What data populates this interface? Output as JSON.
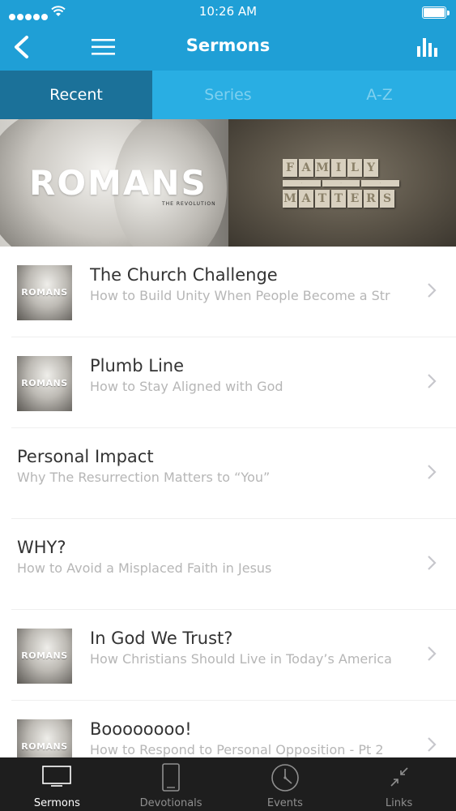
{
  "status_bar": {
    "time": "10:26 AM"
  },
  "nav": {
    "title": "Sermons"
  },
  "tabs": [
    {
      "label": "Recent",
      "active": true
    },
    {
      "label": "Series",
      "active": false
    },
    {
      "label": "A-Z",
      "active": false
    }
  ],
  "banners": [
    {
      "title": "ROMANS",
      "subtitle": "THE REVOLUTION"
    },
    {
      "title": "FAMILY MATTERS"
    }
  ],
  "sermons": [
    {
      "title": "The Church Challenge",
      "subtitle": "How to Build Unity When People Become a Str",
      "thumb": "ROMANS"
    },
    {
      "title": "Plumb Line",
      "subtitle": "How to Stay Aligned with God",
      "thumb": "ROMANS"
    },
    {
      "title": "Personal Impact",
      "subtitle": "Why The Resurrection Matters to “You”",
      "thumb": ""
    },
    {
      "title": "WHY?",
      "subtitle": "How to Avoid a Misplaced Faith in Jesus",
      "thumb": ""
    },
    {
      "title": "In God We Trust?",
      "subtitle": "How Christians Should Live in Today’s America",
      "thumb": "ROMANS"
    },
    {
      "title": "Boooooooo!",
      "subtitle": "How to Respond to Personal Opposition - Pt 2",
      "thumb": "ROMANS"
    }
  ],
  "tabbar": [
    {
      "label": "Sermons",
      "icon": "tv-icon",
      "active": true
    },
    {
      "label": "Devotionals",
      "icon": "tablet-icon",
      "active": false
    },
    {
      "label": "Events",
      "icon": "clock-icon",
      "active": false
    },
    {
      "label": "Links",
      "icon": "compress-arrows-icon",
      "active": false
    }
  ],
  "colors": {
    "primary": "#1f9fd6",
    "tab_active": "#1b7199",
    "tab_bg": "#29aee3",
    "tabbar_bg": "#1e1e1e"
  }
}
